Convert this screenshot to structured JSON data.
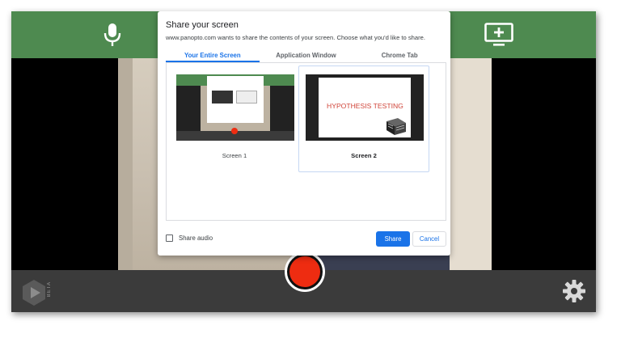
{
  "app": {
    "beta_label": "BETA",
    "icons": {
      "mic": "microphone-icon",
      "screen_share": "screen-share-add-icon",
      "record": "record-icon",
      "settings": "gear-icon",
      "logo": "panopto-logo-icon"
    },
    "colors": {
      "top_bar": "#4e8a50",
      "bottom_bar": "#3b3b3b",
      "record": "#ee2c11"
    }
  },
  "dialog": {
    "title": "Share your screen",
    "subtitle": "www.panopto.com wants to share the contents of your screen. Choose what you'd like to share.",
    "tabs": [
      {
        "label": "Your Entire Screen",
        "active": true
      },
      {
        "label": "Application Window",
        "active": false
      },
      {
        "label": "Chrome Tab",
        "active": false
      }
    ],
    "screens": [
      {
        "label": "Screen 1",
        "selected": false
      },
      {
        "label": "Screen 2",
        "selected": true,
        "slide_text": "HYPOTHESIS TESTING"
      }
    ],
    "share_audio_label": "Share audio",
    "share_audio_checked": false,
    "share_button": "Share",
    "cancel_button": "Cancel",
    "accent_color": "#1a73e8"
  }
}
